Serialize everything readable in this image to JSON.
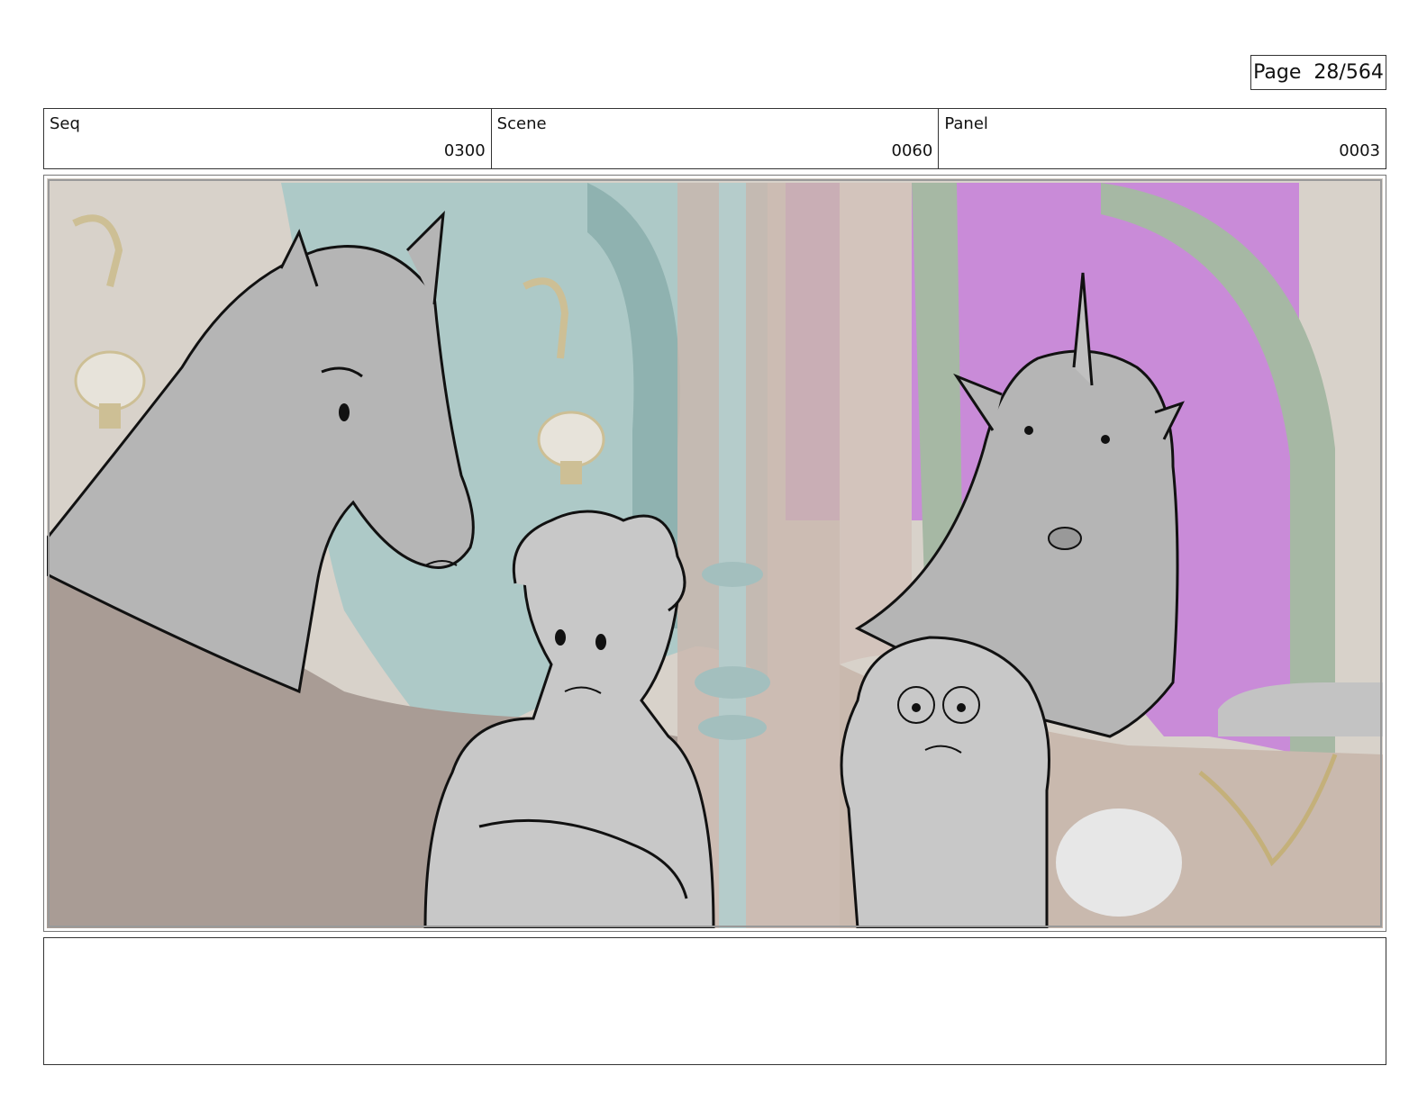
{
  "page": {
    "label": "Page",
    "current": "28",
    "total": "564"
  },
  "info": {
    "seq": {
      "label": "Seq",
      "value": "0300"
    },
    "scene": {
      "label": "Scene",
      "value": "0060"
    },
    "panel": {
      "label": "Panel",
      "value": "0003"
    }
  },
  "notes": {
    "text": ""
  },
  "colors": {
    "background_wall": "#d9d3cb",
    "teal_arch": "#a9c8c6",
    "magenta_window": "#c98bd8",
    "brown_seat": "#a99c95",
    "sketch_fill": "#c8c8c8",
    "line": "#111111"
  }
}
